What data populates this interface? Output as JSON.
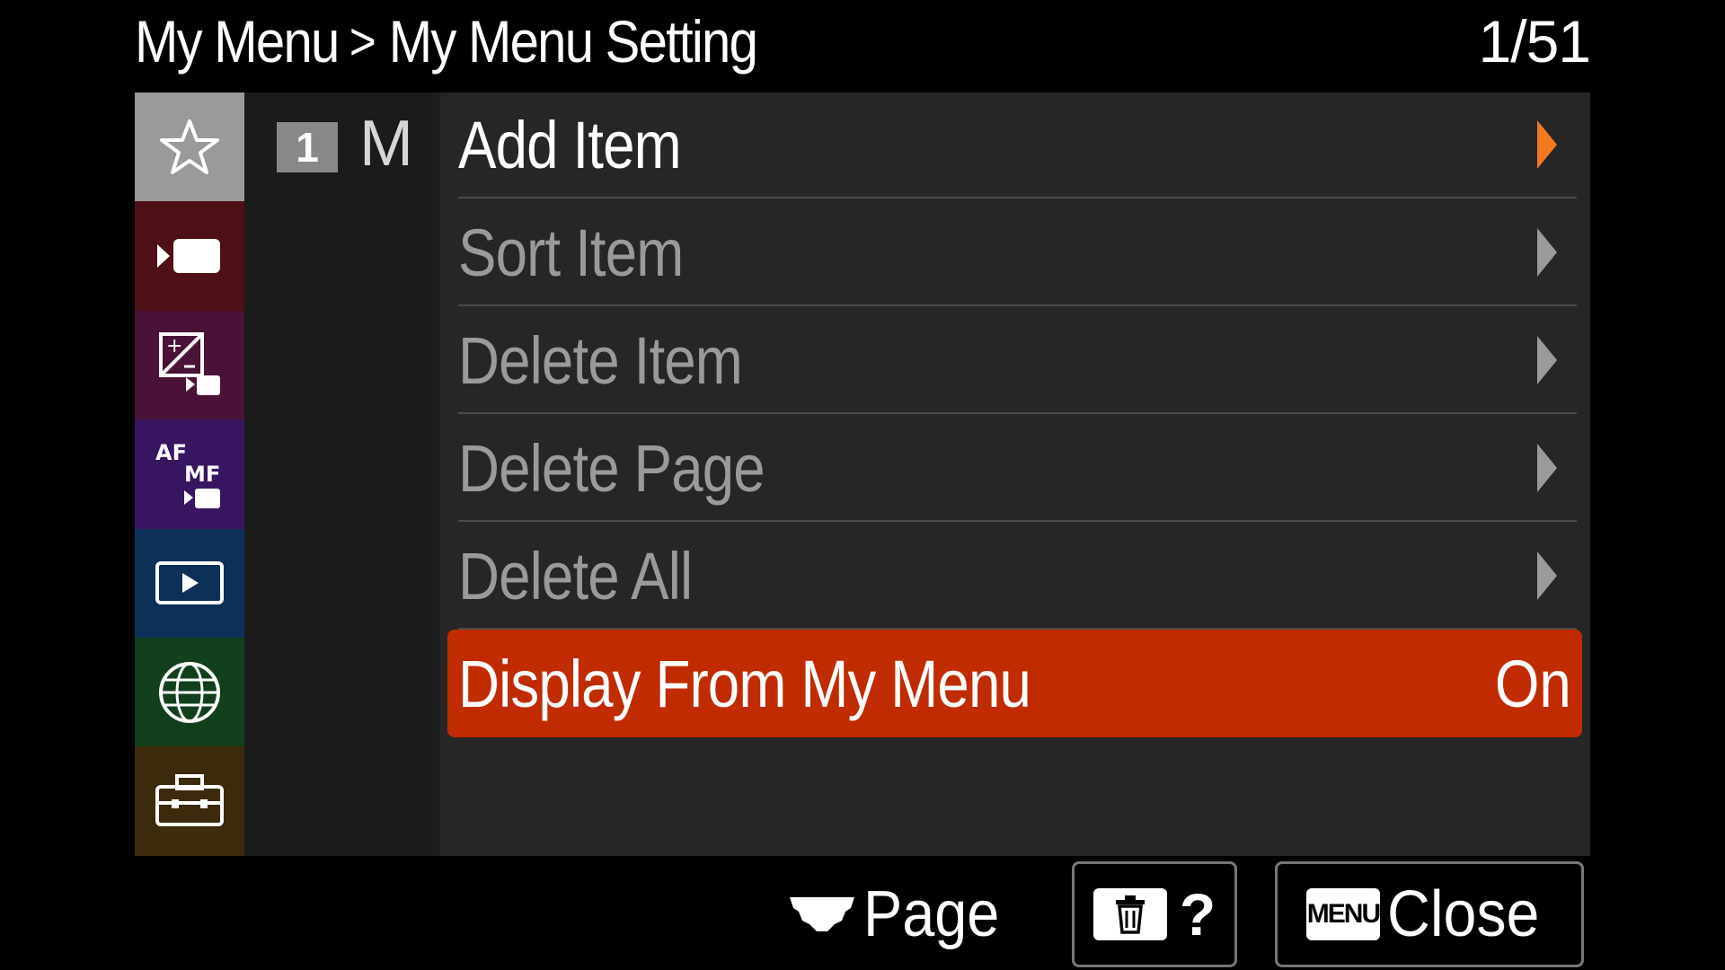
{
  "header": {
    "breadcrumb_root": "My Menu",
    "separator": ">",
    "breadcrumb_current": "My Menu Setting",
    "page_counter": "1/51"
  },
  "tabs": [
    {
      "icon": "star-icon",
      "color": "#9a9a9a",
      "selected": true
    },
    {
      "icon": "movie-camera-icon",
      "color": "#4e0f16"
    },
    {
      "icon": "exposure-color-icon",
      "color": "#4a1236"
    },
    {
      "icon": "af-mf-icon",
      "color": "#381560",
      "af": "AF",
      "mf": "MF"
    },
    {
      "icon": "playback-icon",
      "color": "#0c3058"
    },
    {
      "icon": "globe-icon",
      "color": "#123f1c"
    },
    {
      "icon": "toolbox-icon",
      "color": "#3c2a0c"
    }
  ],
  "page_column": {
    "page_number": "1",
    "page_name": "M"
  },
  "menu": {
    "items": [
      {
        "label": "Add Item"
      },
      {
        "label": "Sort Item"
      },
      {
        "label": "Delete Item"
      },
      {
        "label": "Delete Page"
      },
      {
        "label": "Delete All"
      }
    ],
    "selected": {
      "label": "Display From My Menu",
      "value": "On"
    }
  },
  "footer": {
    "page_hint_label": "Page",
    "help_label": "?",
    "menu_badge": "MENU",
    "close_label": "Close"
  },
  "colors": {
    "accent_arrow": "#f07a1c",
    "selection": "#c02c00"
  }
}
